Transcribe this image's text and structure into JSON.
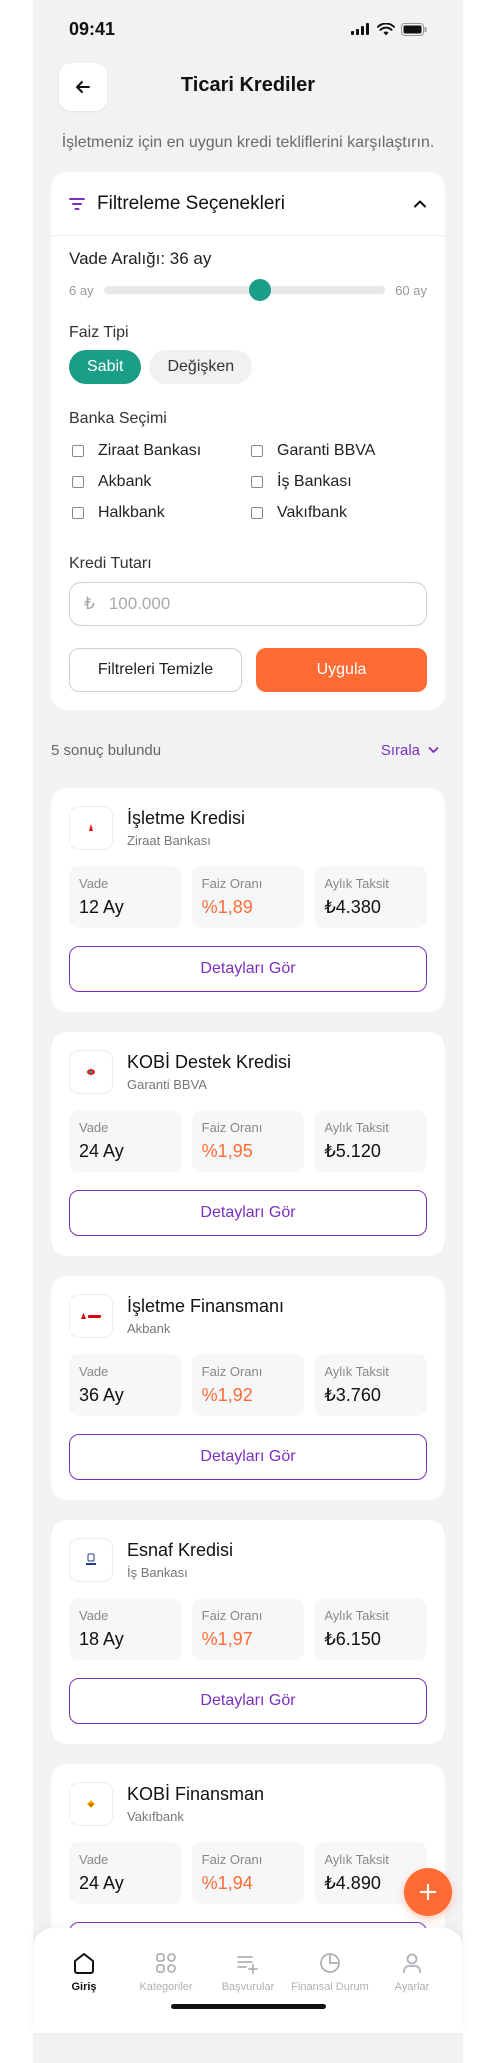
{
  "status": {
    "time": "09:41"
  },
  "header": {
    "title": "Ticari Krediler",
    "back_icon": "arrow-left-icon"
  },
  "subtitle": "İşletmeniz için en uygun kredi tekliflerini karşılaştırın.",
  "filters": {
    "title": "Filtreleme Seçenekleri",
    "vade_label": "Vade Aralığı: 36 ay",
    "slider": {
      "min_label": "6 ay",
      "max_label": "60 ay",
      "min": 6,
      "max": 60,
      "value": 36
    },
    "faiz_label": "Faiz Tipi",
    "faiz_options": [
      "Sabit",
      "Değişken"
    ],
    "faiz_selected": "Sabit",
    "bank_label": "Banka Seçimi",
    "banks": [
      "Ziraat Bankası",
      "Garanti BBVA",
      "Akbank",
      "İş Bankası",
      "Halkbank",
      "Vakıfbank"
    ],
    "amount_label": "Kredi Tutarı",
    "amount_currency": "₺",
    "amount_placeholder": "100.000",
    "clear_label": "Filtreleri Temizle",
    "apply_label": "Uygula"
  },
  "results": {
    "count_text": "5 sonuç bulundu",
    "sort_label": "Sırala",
    "stat_labels": {
      "term": "Vade",
      "rate": "Faiz Oranı",
      "installment": "Aylık Taksit"
    },
    "details_label": "Detayları Gör",
    "loans": [
      {
        "name": "İşletme Kredisi",
        "bank": "Ziraat Bankası",
        "term": "12 Ay",
        "rate": "%1,89",
        "installment": "₺4.380",
        "logo_color": "#e30613"
      },
      {
        "name": "KOBİ Destek Kredisi",
        "bank": "Garanti BBVA",
        "term": "24 Ay",
        "rate": "%1,95",
        "installment": "₺5.120",
        "logo_color": "#d9261c"
      },
      {
        "name": "İşletme Finansmanı",
        "bank": "Akbank",
        "term": "36 Ay",
        "rate": "%1,92",
        "installment": "₺3.760",
        "logo_color": "#dc0005"
      },
      {
        "name": "Esnaf Kredisi",
        "bank": "İş Bankası",
        "term": "18 Ay",
        "rate": "%1,97",
        "installment": "₺6.150",
        "logo_color": "#1e3a8a"
      },
      {
        "name": "KOBİ Finansman",
        "bank": "Vakıfbank",
        "term": "24 Ay",
        "rate": "%1,94",
        "installment": "₺4.890",
        "logo_color": "#f2b600"
      }
    ]
  },
  "nav": {
    "items": [
      {
        "label": "Giriş",
        "icon": "home-icon",
        "active": true
      },
      {
        "label": "Kategoriler",
        "icon": "categories-icon",
        "active": false
      },
      {
        "label": "Başvurular",
        "icon": "applications-icon",
        "active": false
      },
      {
        "label": "Finansal Durum",
        "icon": "pie-chart-icon",
        "active": false
      },
      {
        "label": "Ayarlar",
        "icon": "user-icon",
        "active": false
      }
    ]
  },
  "colors": {
    "accent_purple": "#7b2fbe",
    "accent_orange": "#ff6b35",
    "accent_teal": "#1a9e87"
  }
}
